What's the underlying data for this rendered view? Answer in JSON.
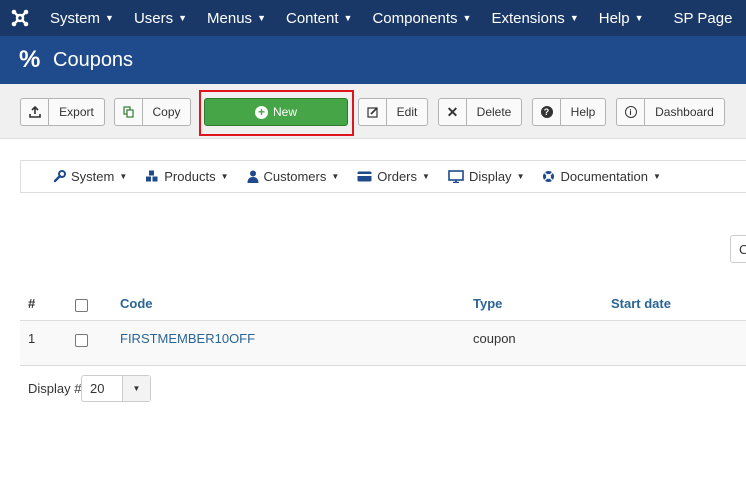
{
  "topnav": {
    "items": [
      {
        "label": "System"
      },
      {
        "label": "Users"
      },
      {
        "label": "Menus"
      },
      {
        "label": "Content"
      },
      {
        "label": "Components"
      },
      {
        "label": "Extensions"
      },
      {
        "label": "Help"
      },
      {
        "label": "SP Page"
      }
    ]
  },
  "header": {
    "title": "Coupons",
    "icon": "percent-icon"
  },
  "toolbar": {
    "export": "Export",
    "copy": "Copy",
    "new": "New",
    "edit": "Edit",
    "delete": "Delete",
    "help": "Help",
    "dashboard": "Dashboard"
  },
  "subnav": {
    "items": [
      {
        "label": "System",
        "icon": "wrench-icon"
      },
      {
        "label": "Products",
        "icon": "cubes-icon"
      },
      {
        "label": "Customers",
        "icon": "user-icon"
      },
      {
        "label": "Orders",
        "icon": "credit-card-icon"
      },
      {
        "label": "Display",
        "icon": "monitor-icon"
      },
      {
        "label": "Documentation",
        "icon": "lifebuoy-icon"
      }
    ]
  },
  "search": {
    "partial_text": "C"
  },
  "table": {
    "headers": {
      "num": "#",
      "code": "Code",
      "type": "Type",
      "start": "Start date"
    },
    "rows": [
      {
        "num": "1",
        "code": "FIRSTMEMBER10OFF",
        "type": "coupon",
        "start": ""
      }
    ]
  },
  "pagination": {
    "label": "Display #",
    "value": "20"
  },
  "colors": {
    "topnav": "#1a3867",
    "header": "#1f4a8b",
    "new_button": "#46a546",
    "highlight": "#e0141c",
    "link": "#2a6496"
  }
}
